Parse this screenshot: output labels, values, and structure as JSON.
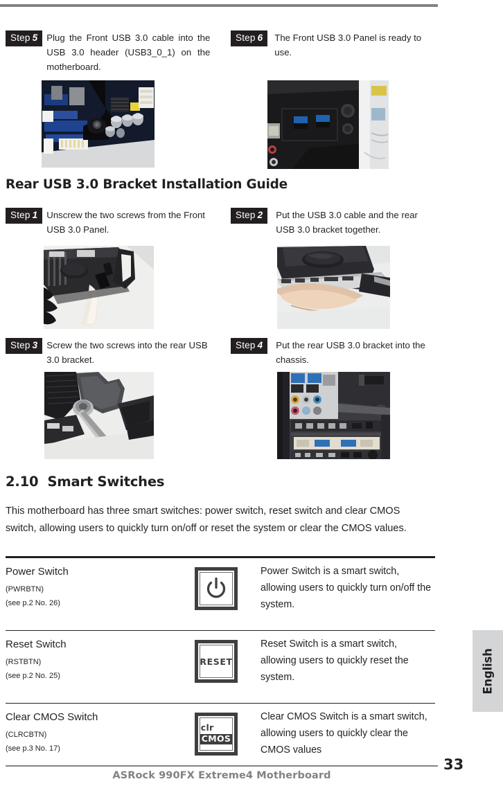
{
  "document": {
    "footer_text": "ASRock  990FX Extreme4  Motherboard",
    "page_number": "33",
    "side_tab_label": "English"
  },
  "front_usb_steps": [
    {
      "badge": "Step",
      "number": "5",
      "text": "Plug the Front USB 3.0 cable into the USB 3.0 header (USB3_0_1) on the motherboard.",
      "photo_alt": "motherboard-usb3-header-photo"
    },
    {
      "badge": "Step",
      "number": "6",
      "text": "The Front USB 3.0 Panel is ready to use.",
      "photo_alt": "front-usb3-panel-photo"
    }
  ],
  "rear_section": {
    "heading": "Rear USB 3.0 Bracket Installation Guide",
    "steps": [
      {
        "badge": "Step",
        "number": "1",
        "text": "Unscrew the two screws from the Front USB 3.0 Panel.",
        "photo_alt": "unscrew-panel-photo"
      },
      {
        "badge": "Step",
        "number": "2",
        "text": "Put the USB 3.0 cable and the rear USB 3.0 bracket together.",
        "photo_alt": "cable-bracket-together-photo"
      },
      {
        "badge": "Step",
        "number": "3",
        "text": "Screw the two screws into the rear USB 3.0 bracket.",
        "photo_alt": "screw-bracket-photo"
      },
      {
        "badge": "Step",
        "number": "4",
        "text": "Put the rear USB 3.0 bracket into the chassis.",
        "photo_alt": "bracket-into-chassis-photo"
      }
    ]
  },
  "smart_switches": {
    "section_number": "2.10",
    "section_title": "Smart Switches",
    "intro": "This motherboard has three smart switches: power switch, reset switch and clear CMOS switch, allowing users to quickly turn on/off or reset the system or clear the CMOS values.",
    "rows": [
      {
        "title": "Power Switch",
        "code": "(PWRBTN)",
        "reference": "(see p.2  No. 26)",
        "icon": "power-symbol-icon",
        "description": "Power Switch is a smart switch, allowing users to quickly turn on/off the system."
      },
      {
        "title": "Reset Switch",
        "code": "(RSTBTN)",
        "reference": "(see p.2  No. 25)",
        "icon": "reset-label-icon",
        "icon_label": "RESET",
        "description": "Reset Switch is a smart switch, allowing users to quickly reset the system."
      },
      {
        "title": "Clear CMOS Switch",
        "code": "(CLRCBTN)",
        "reference": "(see p.3  No. 17)",
        "icon": "clr-cmos-label-icon",
        "icon_label_top": "clr",
        "icon_label_bottom": "CMOS",
        "description": "Clear CMOS Switch is a smart switch, allowing users to quickly clear the CMOS values"
      }
    ]
  },
  "colors": {
    "ink": "#231f20",
    "grey_rule": "#808285",
    "side_tab_bg": "#d4d5d7",
    "icon_frame": "#3f3f41"
  }
}
